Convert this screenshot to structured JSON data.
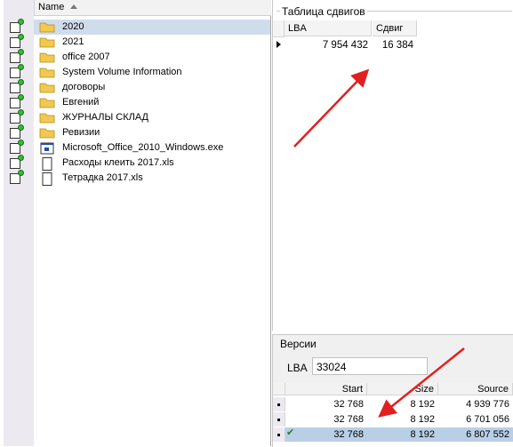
{
  "tree": {
    "column_header": "Name",
    "items": [
      {
        "label": "2020",
        "icon": "folder-icon"
      },
      {
        "label": "2021",
        "icon": "folder-icon"
      },
      {
        "label": "office 2007",
        "icon": "folder-icon"
      },
      {
        "label": "System Volume Information",
        "icon": "folder-icon"
      },
      {
        "label": "договоры",
        "icon": "folder-icon"
      },
      {
        "label": "Евгений",
        "icon": "folder-icon"
      },
      {
        "label": "ЖУРНАЛЫ СКЛАД",
        "icon": "folder-icon"
      },
      {
        "label": "Ревизии",
        "icon": "folder-icon"
      },
      {
        "label": "Microsoft_Office_2010_Windows.exe",
        "icon": "exe-file-icon"
      },
      {
        "label": "Расходы клеить 2017.xls",
        "icon": "file-icon"
      },
      {
        "label": "Тетрадка 2017.xls",
        "icon": "file-icon"
      }
    ]
  },
  "shift_table": {
    "title": "Таблица сдвигов",
    "columns": [
      "LBA",
      "Сдвиг"
    ],
    "rows": [
      {
        "lba": "7 954 432",
        "shift": "16 384"
      }
    ]
  },
  "versions": {
    "title": "Версии",
    "lba_label": "LBA",
    "lba_value": "33024",
    "columns": [
      "Start",
      "Size",
      "Source"
    ],
    "rows": [
      {
        "start": "32 768",
        "size": "8 192",
        "source": "4 939 776"
      },
      {
        "start": "32 768",
        "size": "8 192",
        "source": "6 701 056"
      },
      {
        "start": "32 768",
        "size": "8 192",
        "source": "6 807 552"
      }
    ]
  },
  "colors": {
    "arrow": "#e02020",
    "selection": "#cfdceb",
    "folder": "#f2c94c"
  }
}
